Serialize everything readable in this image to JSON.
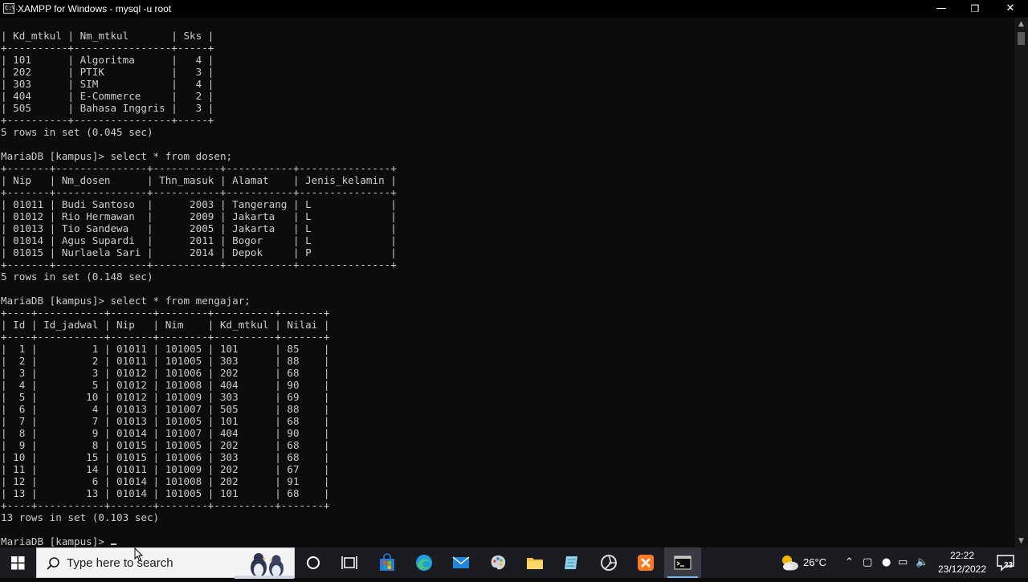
{
  "window": {
    "title": "XAMPP for Windows - mysql  -u root",
    "app_icon_text": "C:\\."
  },
  "console": {
    "lines": [
      "| Kd_mtkul | Nm_mtkul       | Sks |",
      "+----------+----------------+-----+",
      "| 101      | Algoritma      |   4 |",
      "| 202      | PTIK           |   3 |",
      "| 303      | SIM            |   4 |",
      "| 404      | E-Commerce     |   2 |",
      "| 505      | Bahasa Inggris |   3 |",
      "+----------+----------------+-----+",
      "5 rows in set (0.045 sec)",
      "",
      "MariaDB [kampus]> select * from dosen;",
      "+-------+---------------+-----------+-----------+---------------+",
      "| Nip   | Nm_dosen      | Thn_masuk | Alamat    | Jenis_kelamin |",
      "+-------+---------------+-----------+-----------+---------------+",
      "| 01011 | Budi Santoso  |      2003 | Tangerang | L             |",
      "| 01012 | Rio Hermawan  |      2009 | Jakarta   | L             |",
      "| 01013 | Tio Sandewa   |      2005 | Jakarta   | L             |",
      "| 01014 | Agus Supardi  |      2011 | Bogor     | L             |",
      "| 01015 | Nurlaela Sari |      2014 | Depok     | P             |",
      "+-------+---------------+-----------+-----------+---------------+",
      "5 rows in set (0.148 sec)",
      "",
      "MariaDB [kampus]> select * from mengajar;",
      "+----+-----------+-------+--------+----------+-------+",
      "| Id | Id_jadwal | Nip   | Nim    | Kd_mtkul | Nilai |",
      "+----+-----------+-------+--------+----------+-------+",
      "|  1 |         1 | 01011 | 101005 | 101      | 85    |",
      "|  2 |         2 | 01011 | 101005 | 303      | 88    |",
      "|  3 |         3 | 01012 | 101006 | 202      | 68    |",
      "|  4 |         5 | 01012 | 101008 | 404      | 90    |",
      "|  5 |        10 | 01012 | 101009 | 303      | 69    |",
      "|  6 |         4 | 01013 | 101007 | 505      | 88    |",
      "|  7 |         7 | 01013 | 101005 | 101      | 68    |",
      "|  8 |         9 | 01014 | 101007 | 404      | 90    |",
      "|  9 |         8 | 01015 | 101005 | 202      | 68    |",
      "| 10 |        15 | 01015 | 101006 | 303      | 68    |",
      "| 11 |        14 | 01011 | 101009 | 202      | 67    |",
      "| 12 |         6 | 01014 | 101008 | 202      | 91    |",
      "| 13 |        13 | 01014 | 101005 | 101      | 68    |",
      "+----+-----------+-------+--------+----------+-------+",
      "13 rows in set (0.103 sec)",
      ""
    ],
    "prompt": "MariaDB [kampus]> "
  },
  "taskbar": {
    "search_placeholder": "Type here to search",
    "temperature": "26°C",
    "time": "22:22",
    "date": "23/12/2022",
    "notification_count": "23",
    "colors": {
      "background": "#1b1c22",
      "search_bg": "#f3f3f3",
      "active_underline": "#76b9ed"
    }
  }
}
